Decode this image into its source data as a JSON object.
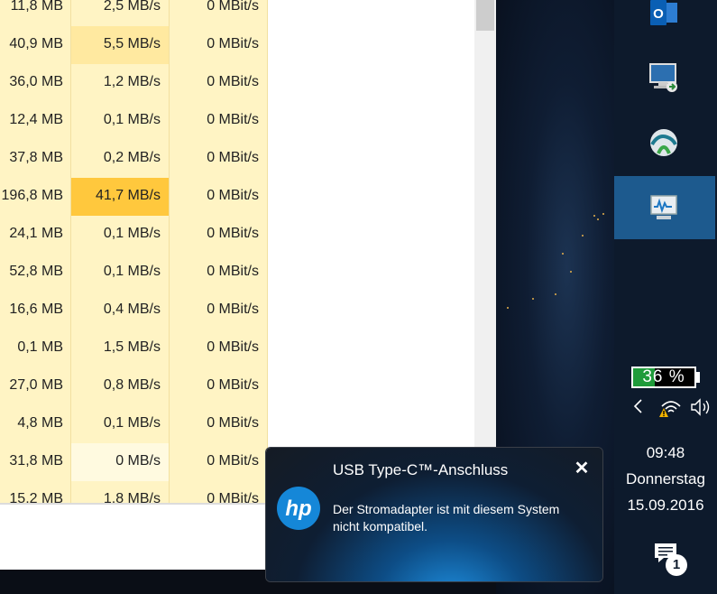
{
  "process_table": {
    "rows": [
      {
        "memory": "11,8 MB",
        "disk": "2,5 MB/s",
        "network": "0 MBit/s",
        "disk_highlight": "#fff4c4"
      },
      {
        "memory": "40,9 MB",
        "disk": "5,5 MB/s",
        "network": "0 MBit/s",
        "disk_highlight": "#ffe9a0"
      },
      {
        "memory": "36,0 MB",
        "disk": "1,2 MB/s",
        "network": "0 MBit/s",
        "disk_highlight": "#fff4c4"
      },
      {
        "memory": "12,4 MB",
        "disk": "0,1 MB/s",
        "network": "0 MBit/s",
        "disk_highlight": "#fff4c4"
      },
      {
        "memory": "37,8 MB",
        "disk": "0,2 MB/s",
        "network": "0 MBit/s",
        "disk_highlight": "#fff4c4"
      },
      {
        "memory": "196,8 MB",
        "disk": "41,7 MB/s",
        "network": "0 MBit/s",
        "disk_highlight": "#ffc83d"
      },
      {
        "memory": "24,1 MB",
        "disk": "0,1 MB/s",
        "network": "0 MBit/s",
        "disk_highlight": "#fff4c4"
      },
      {
        "memory": "52,8 MB",
        "disk": "0,1 MB/s",
        "network": "0 MBit/s",
        "disk_highlight": "#fff4c4"
      },
      {
        "memory": "16,6 MB",
        "disk": "0,4 MB/s",
        "network": "0 MBit/s",
        "disk_highlight": "#fff4c4"
      },
      {
        "memory": "0,1 MB",
        "disk": "1,5 MB/s",
        "network": "0 MBit/s",
        "disk_highlight": "#fff4c4"
      },
      {
        "memory": "27,0 MB",
        "disk": "0,8 MB/s",
        "network": "0 MBit/s",
        "disk_highlight": "#fff4c4"
      },
      {
        "memory": "4,8 MB",
        "disk": "0,1 MB/s",
        "network": "0 MBit/s",
        "disk_highlight": "#fff4c4"
      },
      {
        "memory": "31,8 MB",
        "disk": "0 MB/s",
        "network": "0 MBit/s",
        "disk_highlight": "#fffae0"
      },
      {
        "memory": "15,2 MB",
        "disk": "1,8 MB/s",
        "network": "0 MBit/s",
        "disk_highlight": "#fff4c4"
      }
    ]
  },
  "taskbar": {
    "icons": [
      "outlook-icon",
      "remote-desktop-icon",
      "network-sync-icon",
      "resource-monitor-icon"
    ],
    "battery_percent": "36 %",
    "battery_level": 0.36,
    "time": "09:48",
    "day": "Donnerstag",
    "date": "15.09.2016",
    "notification_count": "1",
    "colors": {
      "active_icon_bg": "#1d5a8e",
      "battery_fill": "#1f9b3a"
    }
  },
  "toast": {
    "title": "USB Type-C™-Anschluss",
    "message": "Der Stromadapter ist mit diesem System nicht kompatibel.",
    "close_glyph": "✕",
    "logo_text": "hp"
  }
}
